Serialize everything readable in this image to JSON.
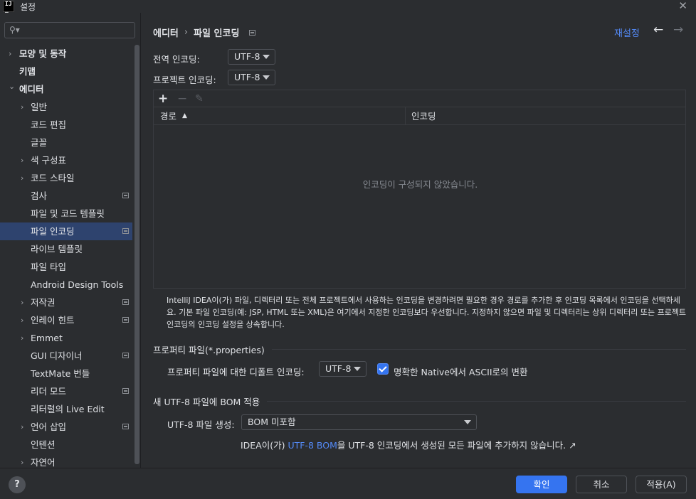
{
  "window": {
    "title": "설정"
  },
  "sidebar": {
    "search_placeholder": "",
    "items": [
      {
        "label": "모양 및 동작",
        "chevron": true,
        "level": 0,
        "bold": true,
        "modified": false
      },
      {
        "label": "키맵",
        "chevron": false,
        "level": 0,
        "bold": true,
        "modified": false
      },
      {
        "label": "에디터",
        "chevron": "down",
        "level": 0,
        "bold": true,
        "modified": false
      },
      {
        "label": "일반",
        "chevron": true,
        "level": 1,
        "modified": false
      },
      {
        "label": "코드 편집",
        "chevron": false,
        "level": 1,
        "modified": false
      },
      {
        "label": "글꼴",
        "chevron": false,
        "level": 1,
        "modified": false
      },
      {
        "label": "색 구성표",
        "chevron": true,
        "level": 1,
        "modified": false
      },
      {
        "label": "코드 스타일",
        "chevron": true,
        "level": 1,
        "modified": false
      },
      {
        "label": "검사",
        "chevron": false,
        "level": 1,
        "modified": true
      },
      {
        "label": "파일 및 코드 템플릿",
        "chevron": false,
        "level": 1,
        "modified": false
      },
      {
        "label": "파일 인코딩",
        "chevron": false,
        "level": 1,
        "modified": true,
        "selected": true
      },
      {
        "label": "라이브 템플릿",
        "chevron": false,
        "level": 1,
        "modified": false
      },
      {
        "label": "파일 타입",
        "chevron": false,
        "level": 1,
        "modified": false
      },
      {
        "label": "Android Design Tools",
        "chevron": false,
        "level": 1,
        "modified": false
      },
      {
        "label": "저작권",
        "chevron": true,
        "level": 1,
        "modified": true
      },
      {
        "label": "인레이 힌트",
        "chevron": true,
        "level": 1,
        "modified": true
      },
      {
        "label": "Emmet",
        "chevron": true,
        "level": 1,
        "modified": false
      },
      {
        "label": "GUI 디자이너",
        "chevron": false,
        "level": 1,
        "modified": true
      },
      {
        "label": "TextMate 번들",
        "chevron": false,
        "level": 1,
        "modified": false
      },
      {
        "label": "리더 모드",
        "chevron": false,
        "level": 1,
        "modified": true
      },
      {
        "label": "리터럴의 Live Edit",
        "chevron": false,
        "level": 1,
        "modified": false
      },
      {
        "label": "언어 삽입",
        "chevron": true,
        "level": 1,
        "modified": true
      },
      {
        "label": "인텐션",
        "chevron": false,
        "level": 1,
        "modified": false
      },
      {
        "label": "자연어",
        "chevron": true,
        "level": 1,
        "modified": false
      }
    ]
  },
  "header": {
    "breadcrumb_parent": "에디터",
    "breadcrumb_separator": "›",
    "breadcrumb_current": "파일 인코딩",
    "reset_label": "재설정",
    "back_icon": "←",
    "forward_icon": "→"
  },
  "encoding": {
    "global_label": "전역 인코딩:",
    "global_value": "UTF-8",
    "project_label": "프로젝트 인코딩:",
    "project_value": "UTF-8"
  },
  "table": {
    "add_icon": "+",
    "remove_icon": "−",
    "edit_icon": "✎",
    "columns": [
      "경로",
      "인코딩"
    ],
    "sort_indicator": "▲",
    "empty_text": "인코딩이 구성되지 않았습니다."
  },
  "description": "IntelliJ IDEA이(가) 파일, 디렉터리 또는 전체 프로젝트에서 사용하는 인코딩을 변경하려면 필요한 경우 경로를 추가한 후 인코딩 목록에서 인코딩을 선택하세요. 기본 파일 인코딩(예: JSP, HTML 또는 XML)은 여기에서 지정한 인코딩보다 우선합니다. 지정하지 않으면 파일 및 디렉터리는 상위 디렉터리 또는 프로젝트 인코딩의 인코딩 설정을 상속합니다.",
  "properties": {
    "section_title": "프로퍼티 파일(*.properties)",
    "default_label": "프로퍼티 파일에 대한 디폴트 인코딩:",
    "default_value": "UTF-8",
    "native_to_ascii_label": "명확한 Native에서 ASCII로의 변환",
    "native_to_ascii_checked": true
  },
  "bom": {
    "section_title": "새 UTF-8 파일에 BOM 적용",
    "create_label": "UTF-8 파일 생성:",
    "create_value": "BOM 미포함",
    "hint_prefix": "IDEA이(가) ",
    "hint_link": "UTF-8 BOM",
    "hint_suffix": "을 UTF-8 인코딩에서 생성된 모든 파일에 추가하지 않습니다. ↗"
  },
  "footer": {
    "help_label": "?",
    "ok_label": "확인",
    "cancel_label": "취소",
    "apply_label": "적용(A)"
  },
  "colors": {
    "accent": "#3574f0",
    "link": "#548af7",
    "selection": "#2e436e",
    "background": "#2b2d30"
  }
}
